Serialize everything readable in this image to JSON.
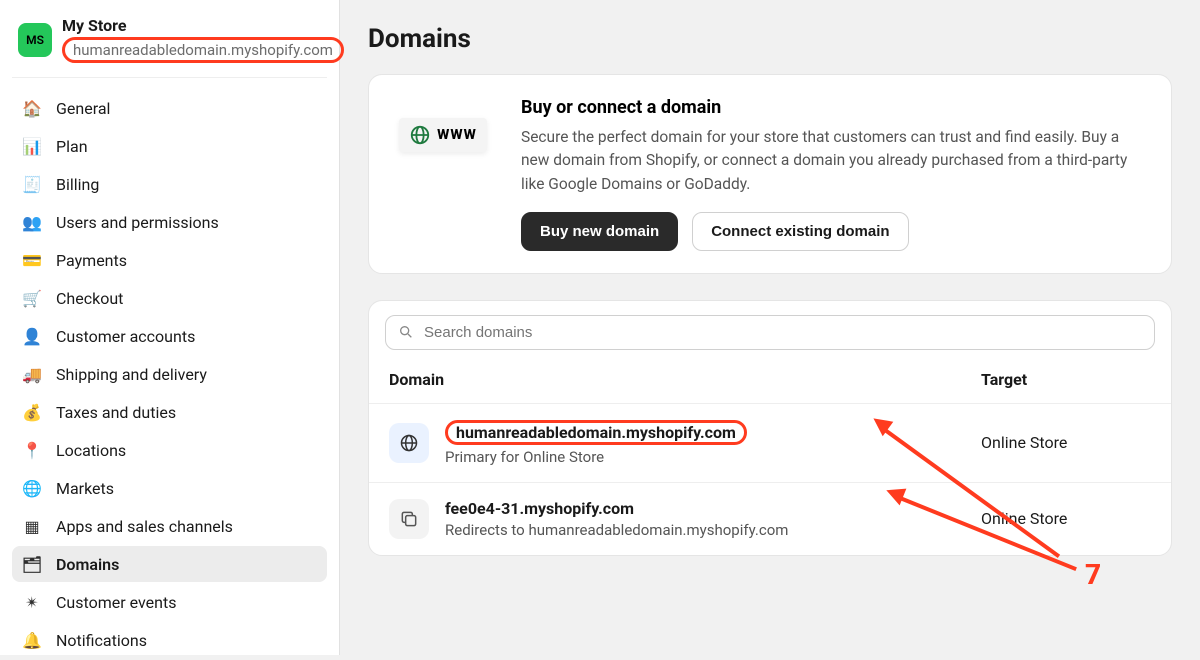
{
  "store": {
    "avatar_initials": "MS",
    "name": "My Store",
    "domain": "humanreadabledomain.myshopify.com"
  },
  "sidebar": {
    "items": [
      {
        "label": "General",
        "icon": "🏠"
      },
      {
        "label": "Plan",
        "icon": "📊"
      },
      {
        "label": "Billing",
        "icon": "🧾"
      },
      {
        "label": "Users and permissions",
        "icon": "👥"
      },
      {
        "label": "Payments",
        "icon": "💳"
      },
      {
        "label": "Checkout",
        "icon": "🛒"
      },
      {
        "label": "Customer accounts",
        "icon": "👤"
      },
      {
        "label": "Shipping and delivery",
        "icon": "🚚"
      },
      {
        "label": "Taxes and duties",
        "icon": "💰"
      },
      {
        "label": "Locations",
        "icon": "📍"
      },
      {
        "label": "Markets",
        "icon": "🌐"
      },
      {
        "label": "Apps and sales channels",
        "icon": "▦"
      },
      {
        "label": "Domains",
        "icon": "🗂"
      },
      {
        "label": "Customer events",
        "icon": "✴"
      },
      {
        "label": "Notifications",
        "icon": "🔔"
      }
    ],
    "active_index": 12
  },
  "page": {
    "title": "Domains",
    "promo": {
      "title": "Buy or connect a domain",
      "description": "Secure the perfect domain for your store that customers can trust and find easily. Buy a new domain from Shopify, or connect a domain you already purchased from a third-party like Google Domains or GoDaddy.",
      "primary_button": "Buy new domain",
      "secondary_button": "Connect existing domain",
      "www_label": "WWW"
    },
    "search_placeholder": "Search domains",
    "columns": {
      "domain": "Domain",
      "target": "Target"
    },
    "rows": [
      {
        "domain": "humanreadabledomain.myshopify.com",
        "subtitle": "Primary for Online Store",
        "target": "Online Store",
        "icon": "globe",
        "circled": true
      },
      {
        "domain": "fee0e4-31.myshopify.com",
        "subtitle": "Redirects to humanreadabledomain.myshopify.com",
        "target": "Online Store",
        "icon": "redirect",
        "circled": false
      }
    ]
  },
  "annotation": {
    "label": "7"
  }
}
